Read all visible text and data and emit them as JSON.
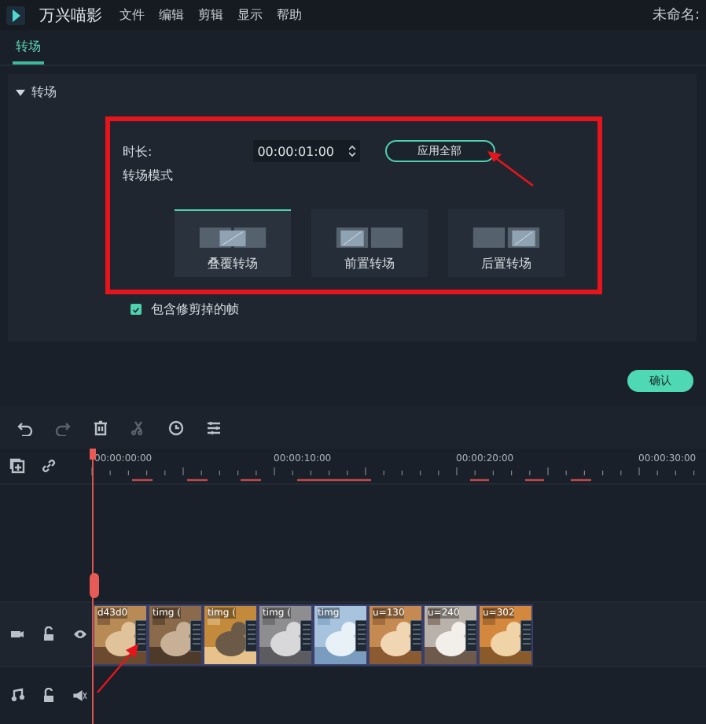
{
  "app": {
    "name": "万兴喵影",
    "menu": [
      "文件",
      "编辑",
      "剪辑",
      "显示",
      "帮助"
    ],
    "project": "未命名:"
  },
  "tabs": [
    {
      "label": "转场",
      "selected": true
    }
  ],
  "section": {
    "title": "转场",
    "expanded": true,
    "duration_label": "时长:",
    "duration": "00:00:01:00",
    "apply_all": "应用全部",
    "mode_label": "转场模式",
    "modes": [
      {
        "label": "叠覆转场",
        "kind": "overlap",
        "selected": true
      },
      {
        "label": "前置转场",
        "kind": "prefix",
        "selected": false
      },
      {
        "label": "后置转场",
        "kind": "suffix",
        "selected": false
      }
    ],
    "include_trimmed": {
      "label": "包含修剪掉的帧",
      "checked": true
    }
  },
  "confirm": "确认",
  "timeline": {
    "ticks": [
      "00:00:00:00",
      "00:00:10:00",
      "00:00:20:00",
      "00:00:30:00"
    ],
    "clips": [
      {
        "label": "d43d0"
      },
      {
        "label": "timg ("
      },
      {
        "label": "timg ("
      },
      {
        "label": "timg ("
      },
      {
        "label": "timg"
      },
      {
        "label": "u=130"
      },
      {
        "label": "u=240"
      },
      {
        "label": "u=302"
      }
    ]
  }
}
